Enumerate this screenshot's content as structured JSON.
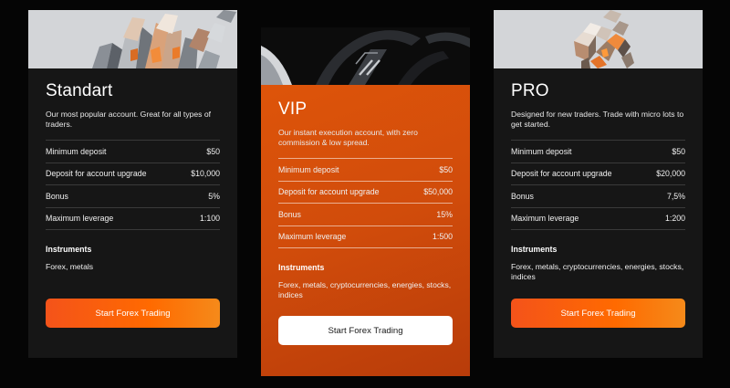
{
  "colors": {
    "page_bg": "#050505",
    "card_bg": "#161616",
    "accent_orange": "#f4531a",
    "vip_gradient_start": "#e2570a",
    "vip_gradient_end": "#b83c0a"
  },
  "cards": [
    {
      "title": "Standart",
      "description": "Our most popular account. Great for all types of traders.",
      "rows": [
        {
          "label": "Minimum deposit",
          "value": "$50"
        },
        {
          "label": "Deposit for account upgrade",
          "value": "$10,000"
        },
        {
          "label": "Bonus",
          "value": "5%"
        },
        {
          "label": "Maximum leverage",
          "value": "1:100"
        }
      ],
      "instruments_heading": "Instruments",
      "instruments": "Forex, metals",
      "button_label": "Start Forex Trading"
    },
    {
      "title": "VIP",
      "description": "Our instant execution account, with zero commission & low spread.",
      "rows": [
        {
          "label": "Minimum deposit",
          "value": "$50"
        },
        {
          "label": "Deposit for account upgrade",
          "value": "$50,000"
        },
        {
          "label": "Bonus",
          "value": "15%"
        },
        {
          "label": "Maximum leverage",
          "value": "1:500"
        }
      ],
      "instruments_heading": "Instruments",
      "instruments": "Forex, metals, cryptocurrencies, energies, stocks, indices",
      "button_label": "Start Forex Trading"
    },
    {
      "title": "PRO",
      "description": "Designed for new traders. Trade with micro lots to get started.",
      "rows": [
        {
          "label": "Minimum deposit",
          "value": "$50"
        },
        {
          "label": "Deposit for account upgrade",
          "value": "$20,000"
        },
        {
          "label": "Bonus",
          "value": "7,5%"
        },
        {
          "label": "Maximum leverage",
          "value": "1:200"
        }
      ],
      "instruments_heading": "Instruments",
      "instruments": "Forex, metals, cryptocurrencies, energies, stocks, indices",
      "button_label": "Start Forex Trading"
    }
  ]
}
